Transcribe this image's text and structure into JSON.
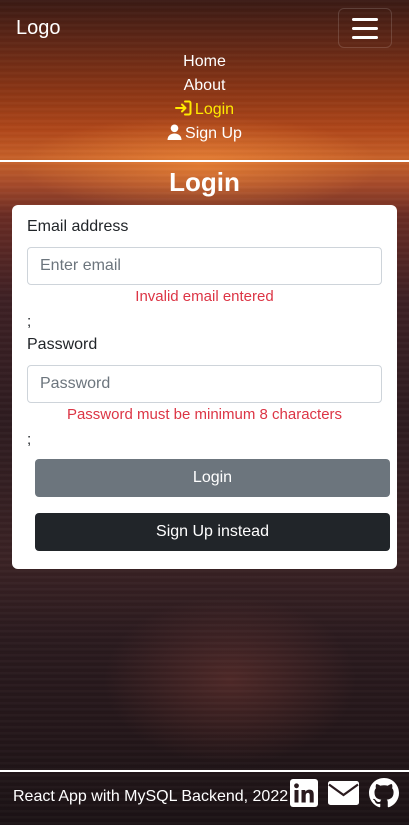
{
  "navbar": {
    "logo": "Logo",
    "toggler_icon": "hamburger-menu-icon",
    "links": [
      {
        "label": "Home"
      },
      {
        "label": "About"
      },
      {
        "label": "Login",
        "icon": "login-arrow-icon",
        "active": true,
        "active_color": "#ffeb00"
      },
      {
        "label": "Sign Up",
        "icon": "user-icon"
      }
    ]
  },
  "page": {
    "title": "Login"
  },
  "form": {
    "email_label": "Email address",
    "email_placeholder": "Enter email",
    "email_value": "",
    "email_error": "Invalid email entered",
    "semicolon_1": ";",
    "password_label": "Password",
    "password_placeholder": "Password",
    "password_value": "",
    "password_error": "Password must be minimum 8 characters",
    "semicolon_2": ";",
    "login_button": "Login",
    "signup_button": "Sign Up instead"
  },
  "footer": {
    "text": "React App with MySQL Backend, 2022",
    "icons": [
      "linkedin-icon",
      "envelope-icon",
      "github-icon"
    ]
  },
  "colors": {
    "error": "#dc3545",
    "login_button": "#6c757d",
    "signup_button": "#212529",
    "active_link": "#ffeb00"
  }
}
